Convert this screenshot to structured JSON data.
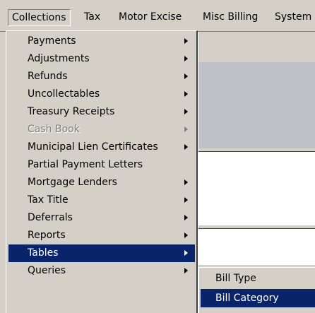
{
  "menubar": {
    "items": [
      "Collections",
      "Tax",
      "Motor Excise",
      "Misc Billing",
      "System"
    ]
  },
  "collections_menu": {
    "items": [
      {
        "label": "Payments",
        "submenu": true,
        "enabled": true
      },
      {
        "label": "Adjustments",
        "submenu": true,
        "enabled": true
      },
      {
        "label": "Refunds",
        "submenu": true,
        "enabled": true
      },
      {
        "label": "Uncollectables",
        "submenu": true,
        "enabled": true
      },
      {
        "label": "Treasury Receipts",
        "submenu": true,
        "enabled": true
      },
      {
        "label": "Cash Book",
        "submenu": true,
        "enabled": false
      },
      {
        "label": "Municipal Lien Certificates",
        "submenu": true,
        "enabled": true
      },
      {
        "label": "Partial Payment Letters",
        "submenu": false,
        "enabled": true
      },
      {
        "label": "Mortgage Lenders",
        "submenu": true,
        "enabled": true
      },
      {
        "label": "Tax Title",
        "submenu": true,
        "enabled": true
      },
      {
        "label": "Deferrals",
        "submenu": true,
        "enabled": true
      },
      {
        "label": "Reports",
        "submenu": true,
        "enabled": true
      },
      {
        "label": "Tables",
        "submenu": true,
        "enabled": true,
        "selected": true
      },
      {
        "label": "Queries",
        "submenu": true,
        "enabled": true
      }
    ]
  },
  "tables_submenu": {
    "items": [
      {
        "label": "Bill Type"
      },
      {
        "label": "Bill Category",
        "selected": true
      }
    ]
  },
  "colors": {
    "menu_face": "#d4d0c8",
    "highlight": "#0a246a",
    "highlight_text": "#ffffff",
    "disabled_text": "#808080"
  }
}
